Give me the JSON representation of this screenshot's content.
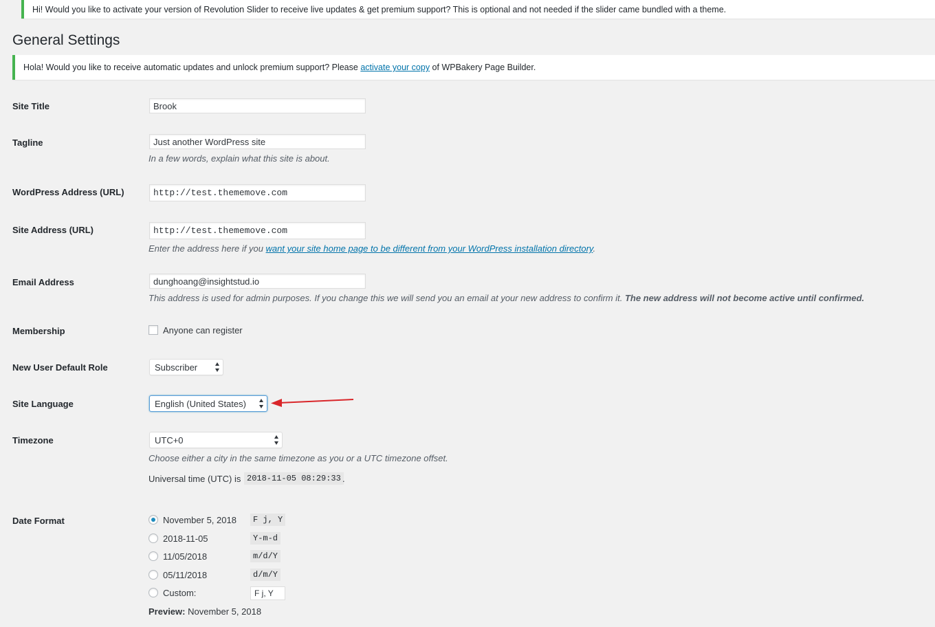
{
  "notices": {
    "revslider": "Hi! Would you like to activate your version of Revolution Slider to receive live updates & get premium support? This is optional and not needed if the slider came bundled with a theme.",
    "wpbakery_before": "Hola! Would you like to receive automatic updates and unlock premium support? Please ",
    "wpbakery_link": "activate your copy",
    "wpbakery_after": " of WPBakery Page Builder."
  },
  "page_title": "General Settings",
  "fields": {
    "site_title": {
      "label": "Site Title",
      "value": "Brook"
    },
    "tagline": {
      "label": "Tagline",
      "value": "Just another WordPress site",
      "desc": "In a few words, explain what this site is about."
    },
    "wp_address": {
      "label": "WordPress Address (URL)",
      "value": "http://test.thememove.com"
    },
    "site_address": {
      "label": "Site Address (URL)",
      "value": "http://test.thememove.com",
      "desc_before": "Enter the address here if you ",
      "desc_link": "want your site home page to be different from your WordPress installation directory",
      "desc_after": "."
    },
    "email": {
      "label": "Email Address",
      "value": "dunghoang@insightstud.io",
      "desc_plain": "This address is used for admin purposes. If you change this we will send you an email at your new address to confirm it. ",
      "desc_bold": "The new address will not become active until confirmed."
    },
    "membership": {
      "label": "Membership",
      "checkbox_label": "Anyone can register",
      "checked": false
    },
    "default_role": {
      "label": "New User Default Role",
      "value": "Subscriber"
    },
    "site_language": {
      "label": "Site Language",
      "value": "English (United States)"
    },
    "timezone": {
      "label": "Timezone",
      "value": "UTC+0",
      "desc": "Choose either a city in the same timezone as you or a UTC timezone offset.",
      "utc_label": "Universal time (UTC) is ",
      "utc_value": "2018-11-05 08:29:33",
      "utc_after": "."
    },
    "date_format": {
      "label": "Date Format",
      "options": [
        {
          "label": "November 5, 2018",
          "code": "F j, Y",
          "checked": true
        },
        {
          "label": "2018-11-05",
          "code": "Y-m-d",
          "checked": false
        },
        {
          "label": "11/05/2018",
          "code": "m/d/Y",
          "checked": false
        },
        {
          "label": "05/11/2018",
          "code": "d/m/Y",
          "checked": false
        }
      ],
      "custom_label": "Custom:",
      "custom_value": "F j, Y",
      "preview_label": "Preview:",
      "preview_value": " November 5, 2018"
    }
  },
  "colors": {
    "notice_border": "#46b450",
    "link": "#0073aa",
    "annotation_arrow": "#d9262a",
    "radio_dot": "#1e8cbe"
  }
}
